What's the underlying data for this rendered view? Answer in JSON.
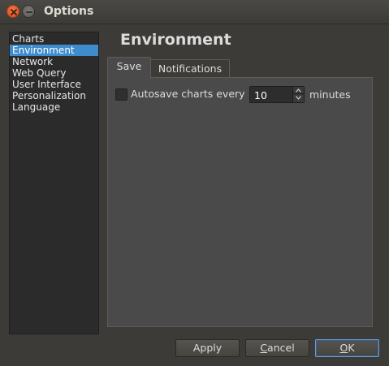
{
  "window": {
    "title": "Options"
  },
  "sidebar": {
    "items": [
      {
        "label": "Charts",
        "selected": false
      },
      {
        "label": "Environment",
        "selected": true
      },
      {
        "label": "Network",
        "selected": false
      },
      {
        "label": "Web Query",
        "selected": false
      },
      {
        "label": "User Interface",
        "selected": false
      },
      {
        "label": "Personalization",
        "selected": false
      },
      {
        "label": "Language",
        "selected": false
      }
    ]
  },
  "main": {
    "heading": "Environment",
    "tabs": [
      {
        "label": "Save",
        "active": true
      },
      {
        "label": "Notifications",
        "active": false
      }
    ],
    "save": {
      "autosave_label": "Autosave charts every",
      "autosave_checked": false,
      "interval_value": "10",
      "unit_label": "minutes"
    }
  },
  "buttons": {
    "apply": "Apply",
    "cancel_first": "C",
    "cancel_rest": "ancel",
    "ok_first": "O",
    "ok_rest": "K"
  },
  "colors": {
    "selection": "#3f8ccd",
    "close_button": "#e9602c",
    "window_bg": "#3c3b37"
  }
}
